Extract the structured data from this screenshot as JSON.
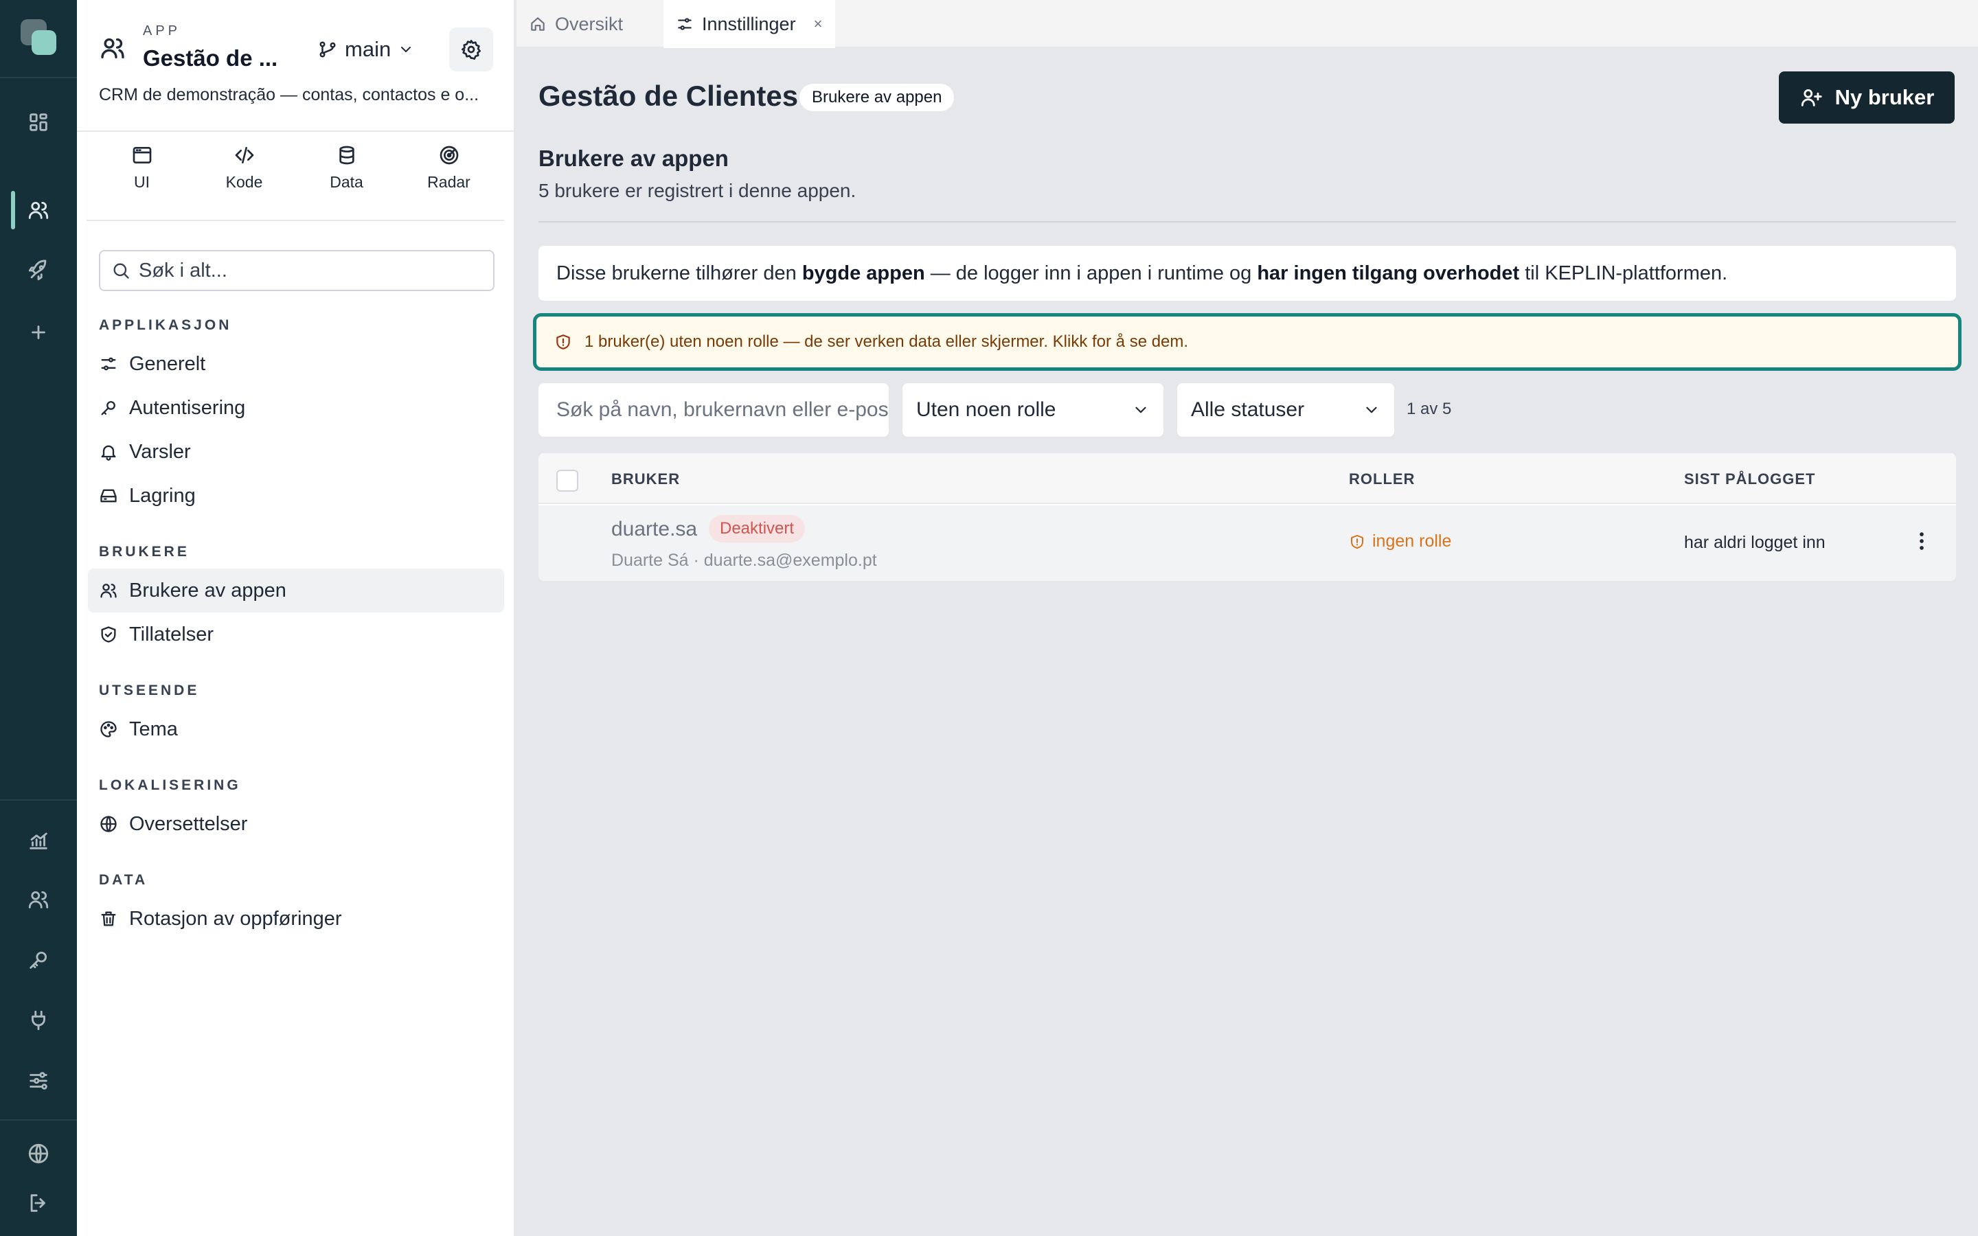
{
  "colors": {
    "rail_bg": "#163039",
    "accent": "#14867d",
    "brand_logo": "#8fd0c4",
    "primary_button": "#14262f",
    "warning_bg": "#fffaeb",
    "deactivated": "#d0554f",
    "no_role": "#d9731b"
  },
  "rail": {
    "items": [
      {
        "icon": "dashboard-icon"
      },
      {
        "icon": "users-icon",
        "active": true
      },
      {
        "icon": "rocket-icon"
      },
      {
        "icon": "plus-icon"
      },
      {
        "icon": "chart-icon"
      },
      {
        "icon": "team-icon"
      },
      {
        "icon": "key-icon"
      },
      {
        "icon": "plug-icon"
      },
      {
        "icon": "sliders-icon"
      },
      {
        "icon": "globe-icon"
      },
      {
        "icon": "logout-icon"
      }
    ]
  },
  "sidebar": {
    "app_kicker": "APP",
    "app_name": "Gestão de ...",
    "branch": "main",
    "description": "CRM de demonstração — contas, contactos e o...",
    "section_tabs": [
      {
        "label": "UI",
        "icon": "window-icon"
      },
      {
        "label": "Kode",
        "icon": "code-icon"
      },
      {
        "label": "Data",
        "icon": "database-icon"
      },
      {
        "label": "Radar",
        "icon": "radar-icon"
      }
    ],
    "search_placeholder": "Søk i alt...",
    "groups": {
      "applikasjon": {
        "title": "APPLIKASJON",
        "items": [
          "Generelt",
          "Autentisering",
          "Varsler",
          "Lagring"
        ]
      },
      "brukere": {
        "title": "BRUKERE",
        "items": [
          "Brukere av appen",
          "Tillatelser"
        ]
      },
      "utseende": {
        "title": "UTSEENDE",
        "items": [
          "Tema"
        ]
      },
      "lokalisering": {
        "title": "LOKALISERING",
        "items": [
          "Oversettelser"
        ]
      },
      "data": {
        "title": "DATA",
        "items": [
          "Rotasjon av oppføringer"
        ]
      }
    },
    "active_item": "Brukere av appen"
  },
  "tabs": [
    {
      "label": "Oversikt",
      "icon": "home-icon"
    },
    {
      "label": "Innstillinger",
      "icon": "settings-sliders-icon",
      "active": true,
      "close": "×"
    }
  ],
  "main": {
    "title": "Gestão de Clientes",
    "title_pill": "Brukere av appen",
    "new_user_label": "Ny bruker",
    "section_title": "Brukere av appen",
    "section_desc": "5 brukere er registrert i denne appen.",
    "info": {
      "p1": "Disse brukerne tilhører den ",
      "b1": "bygde appen",
      "p2": " — de logger inn i appen i runtime og ",
      "b2": "har ingen tilgang overhodet",
      "p3": " til KEPLIN-plattformen."
    },
    "warning": "1 bruker(e) uten noen rolle — de ser verken data eller skjermer. Klikk for å se dem.",
    "filters": {
      "search_placeholder": "Søk på navn, brukernavn eller e-post",
      "role_value": "Uten noen rolle",
      "status_value": "Alle statuser",
      "count": "1 av 5"
    },
    "table": {
      "columns": [
        "BRUKER",
        "ROLLER",
        "SIST PÅLOGGET"
      ],
      "rows": [
        {
          "username": "duarte.sa",
          "status_badge": "Deaktivert",
          "meta": "Duarte Sá · duarte.sa@exemplo.pt",
          "role": "ingen rolle",
          "last_login": "har aldri logget inn"
        }
      ]
    }
  }
}
